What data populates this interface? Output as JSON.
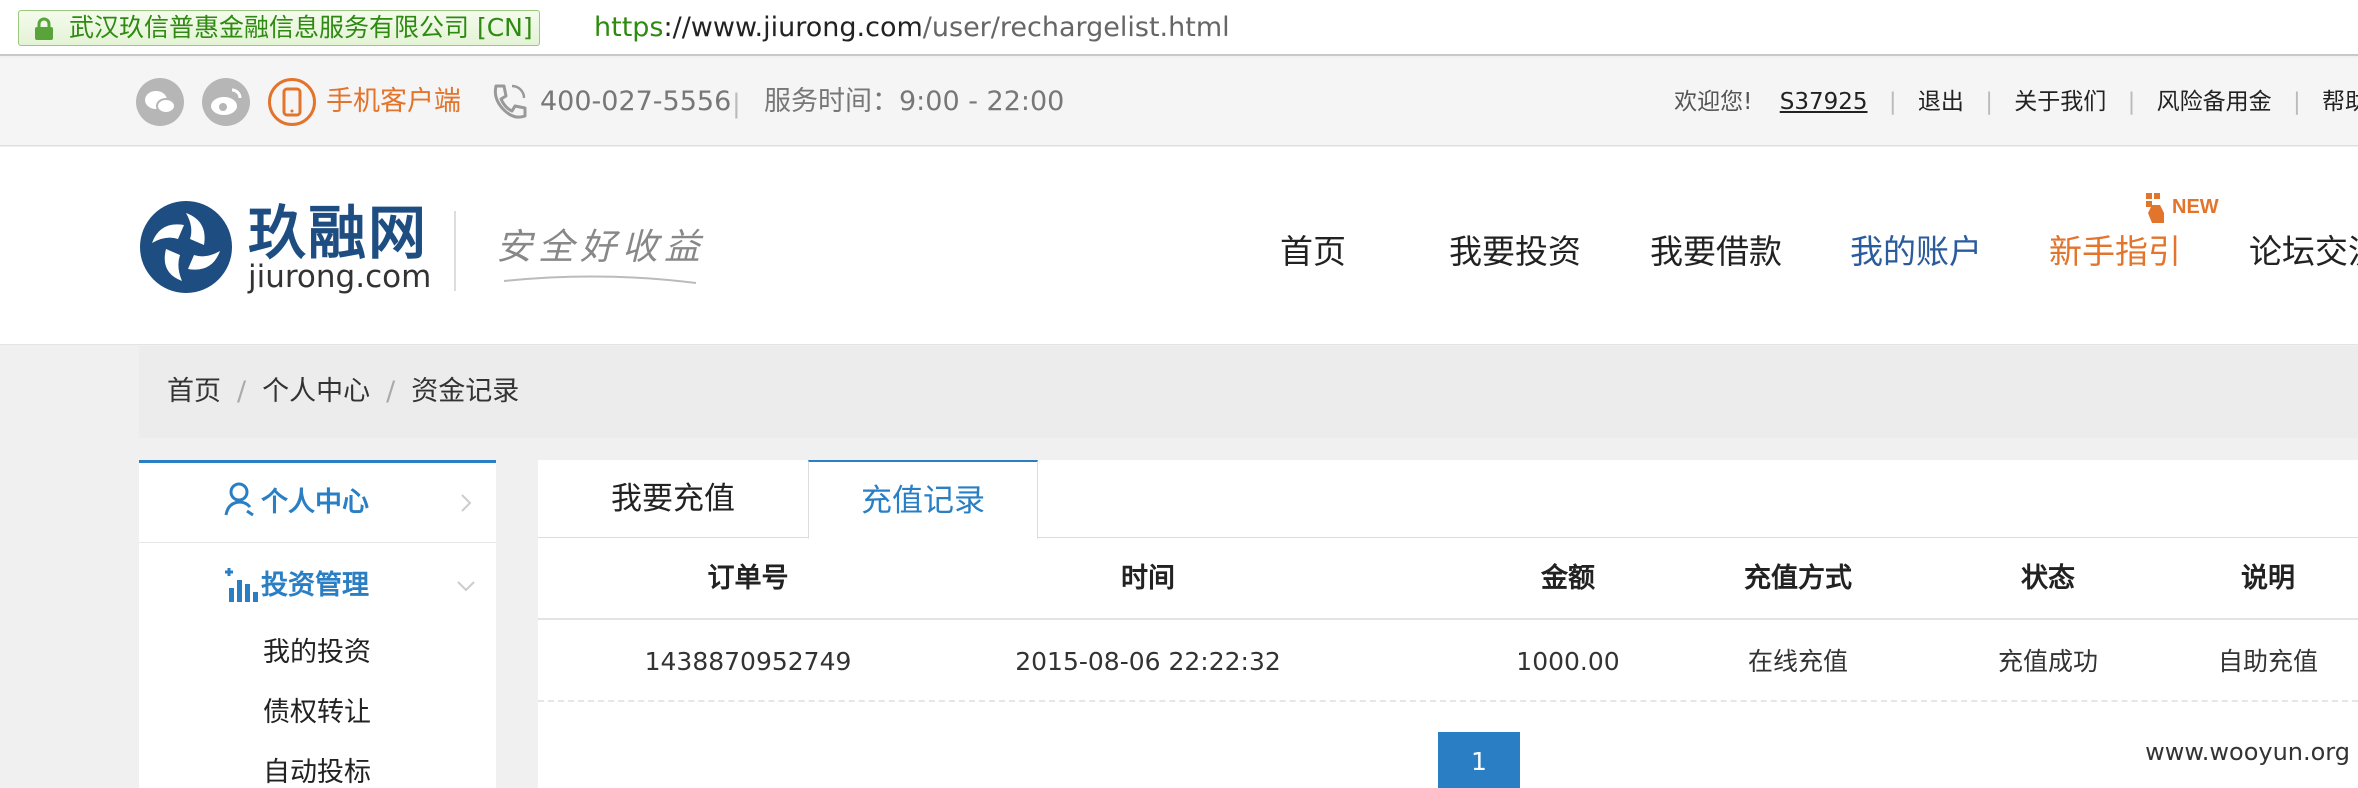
{
  "browser": {
    "secure_label": "武汉玖信普惠金融信息服务有限公司 [CN]",
    "url_proto": "https",
    "url_host": "://www.jiurong.com",
    "url_path": "/user/rechargelist.html"
  },
  "topbar": {
    "app_label": "手机客户端",
    "phone": "400-027-5556",
    "service_hours": "服务时间：9:00 - 22:00",
    "separator": "|",
    "welcome": "欢迎您!",
    "username": "S37925",
    "logout": "退出",
    "about": "关于我们",
    "risk_fund": "风险备用金",
    "help": "帮助"
  },
  "header": {
    "logo_cn": "玖融网",
    "logo_en": "jiurong.com",
    "slogan": "安全好收益",
    "new_badge": "NEW",
    "nav": [
      "首页",
      "我要投资",
      "我要借款",
      "我的账户",
      "新手指引",
      "论坛交流"
    ]
  },
  "breadcrumb": [
    "首页",
    "个人中心",
    "资金记录"
  ],
  "breadcrumb_sep": "/",
  "sidebar": {
    "personal_center": "个人中心",
    "invest_mgmt": "投资管理",
    "sub_items": [
      "我的投资",
      "债权转让",
      "自动投标"
    ]
  },
  "tabs": [
    "我要充值",
    "充值记录"
  ],
  "table": {
    "headers": [
      "订单号",
      "时间",
      "金额",
      "充值方式",
      "状态",
      "说明"
    ],
    "rows": [
      [
        "1438870952749",
        "2015-08-06 22:22:32",
        "1000.00",
        "在线充值",
        "充值成功",
        "自助充值"
      ]
    ]
  },
  "pagination": {
    "current_page": "1"
  },
  "watermark": "www.wooyun.org",
  "colors": {
    "brand_blue": "#2a7fc4",
    "nav_active": "#2a5b9c",
    "accent_orange": "#e2742c",
    "secure_green": "#2f8a12"
  }
}
